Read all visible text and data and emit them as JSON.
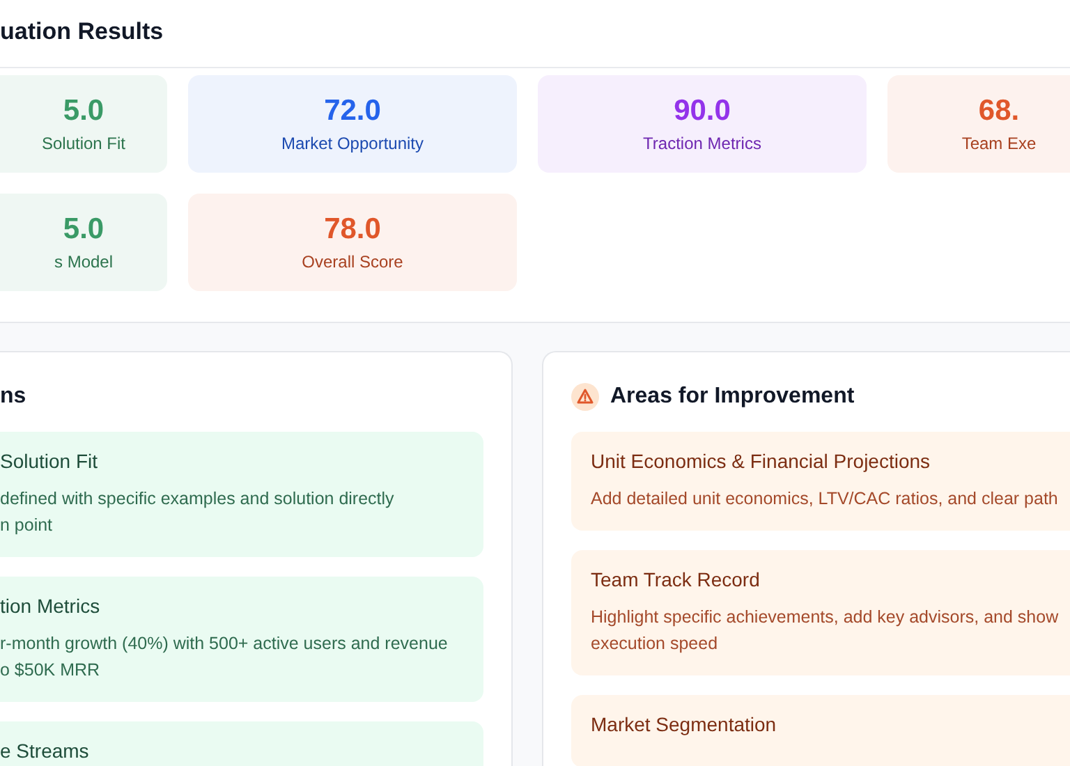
{
  "header": {
    "title": "uation Results"
  },
  "scores": [
    {
      "value": "5.0",
      "label": "Solution Fit",
      "color": "#3a9a66"
    },
    {
      "value": "72.0",
      "label": "Market Opportunity",
      "color": "#2563eb"
    },
    {
      "value": "90.0",
      "label": "Traction Metrics",
      "color": "#9333ea"
    },
    {
      "value": "68.",
      "label": "Team Exe",
      "color": "#e0572a"
    },
    {
      "value": "5.0",
      "label": "s Model",
      "color": "#3a9a66"
    },
    {
      "value": "78.0",
      "label": "Overall Score",
      "color": "#e0572a"
    }
  ],
  "strengths": {
    "title": "ns",
    "items": [
      {
        "title": "Solution Fit",
        "text": "defined with specific examples and solution directly\nn point"
      },
      {
        "title": "tion Metrics",
        "text": "r-month growth (40%) with 500+ active users and revenue\no $50K MRR"
      },
      {
        "title": "e Streams"
      }
    ]
  },
  "improvements": {
    "title": "Areas for Improvement",
    "items": [
      {
        "title": "Unit Economics & Financial Projections",
        "text": "Add detailed unit economics, LTV/CAC ratios, and clear path"
      },
      {
        "title": "Team Track Record",
        "text": "Highlight specific achievements, add key advisors, and show\nexecution speed"
      },
      {
        "title": "Market Segmentation"
      }
    ]
  }
}
